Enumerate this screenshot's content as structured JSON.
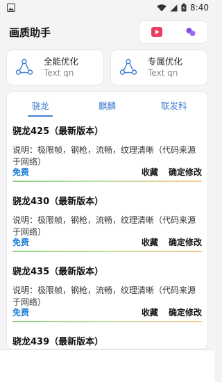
{
  "status": {
    "time": "8:40"
  },
  "header": {
    "title": "画质助手"
  },
  "cards": [
    {
      "title": "全能优化",
      "subtitle": "Text qn",
      "icon": "share-nodes-icon"
    },
    {
      "title": "专属优化",
      "subtitle": "Text qn",
      "icon": "share-nodes-icon"
    }
  ],
  "tabs": [
    {
      "label": "骁龙",
      "active": true
    },
    {
      "label": "麒麟",
      "active": false
    },
    {
      "label": "联发科",
      "active": false
    }
  ],
  "items": [
    {
      "title": "骁龙425（最新版本）",
      "desc": "说明：极限帧，钢枪，流畅，纹理清晰（代码来源于网络）",
      "free": "免费",
      "fav": "收藏",
      "confirm": "确定修改"
    },
    {
      "title": "骁龙430（最新版本）",
      "desc": "说明：极限帧，钢枪，流畅，纹理清晰（代码来源于网络）",
      "free": "免费",
      "fav": "收藏",
      "confirm": "确定修改"
    },
    {
      "title": "骁龙435（最新版本）",
      "desc": "说明：极限帧，钢枪，流畅，纹理清晰（代码来源于网络）",
      "free": "免费",
      "fav": "收藏",
      "confirm": "确定修改"
    },
    {
      "title": "骁龙439（最新版本）"
    }
  ],
  "colors": {
    "accent": "#3f7bd2",
    "free": "#1f7fd8",
    "play": "#f03a5f",
    "dots": "#7b4fe0"
  }
}
